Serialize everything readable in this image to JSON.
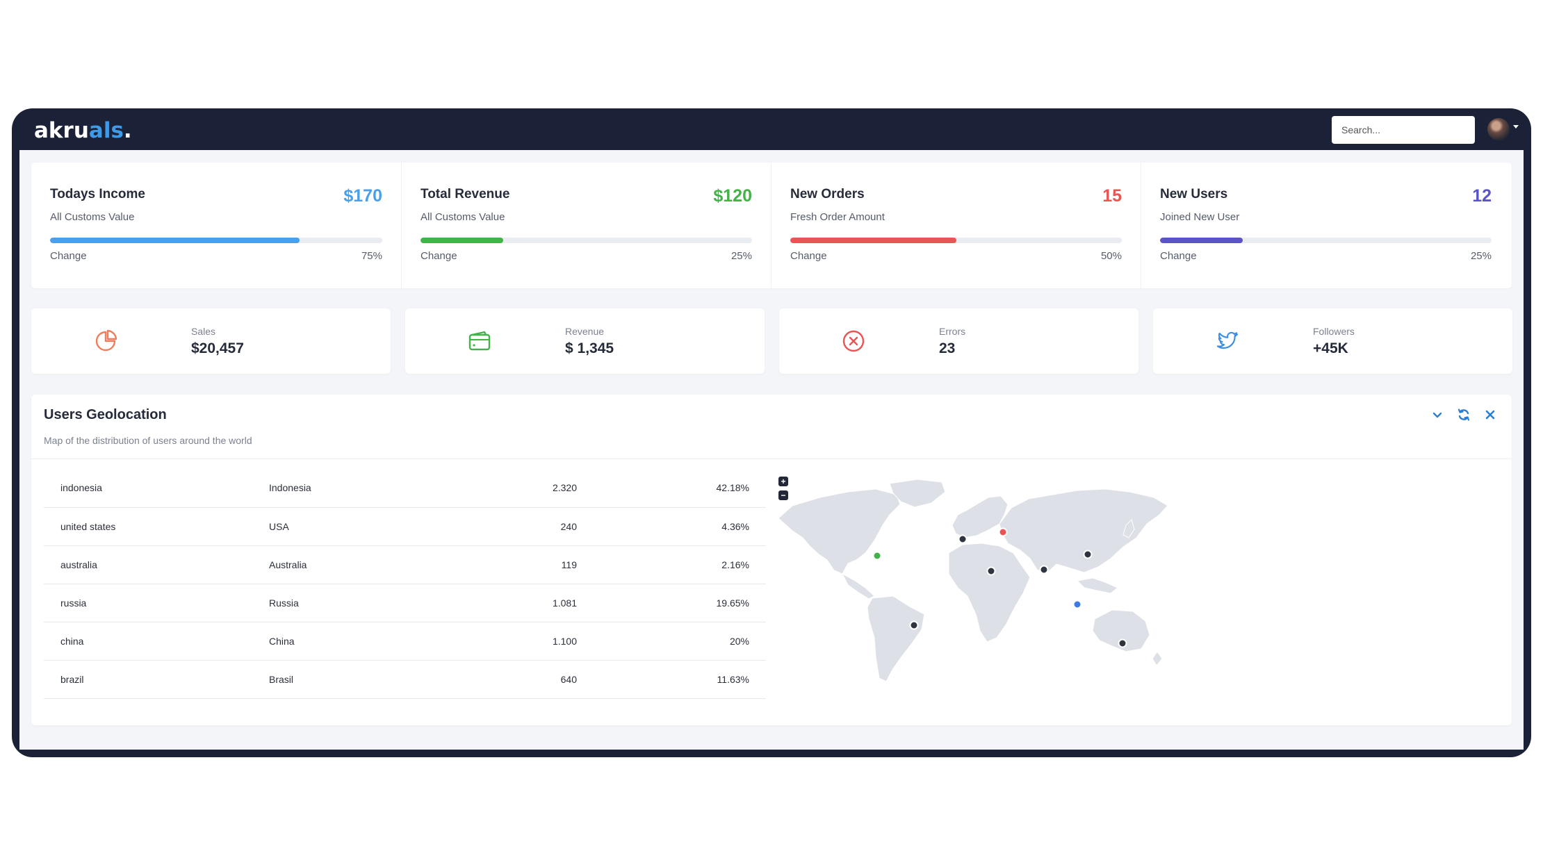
{
  "brand": {
    "logo_main": "akru",
    "logo_accent": "als",
    "logo_end": "."
  },
  "header": {
    "search_placeholder": "Search..."
  },
  "stats": [
    {
      "title": "Todays Income",
      "subtitle": "All Customs Value",
      "value": "$170",
      "change_label": "Change",
      "percent": "75%",
      "progress": 0.75,
      "color": "#4a9fe8"
    },
    {
      "title": "Total Revenue",
      "subtitle": "All Customs Value",
      "value": "$120",
      "change_label": "Change",
      "percent": "25%",
      "progress": 0.25,
      "color": "#43b349"
    },
    {
      "title": "New Orders",
      "subtitle": "Fresh Order Amount",
      "value": "15",
      "change_label": "Change",
      "percent": "50%",
      "progress": 0.5,
      "color": "#e95454"
    },
    {
      "title": "New Users",
      "subtitle": "Joined New User",
      "value": "12",
      "change_label": "Change",
      "percent": "25%",
      "progress": 0.25,
      "color": "#5b54c9"
    }
  ],
  "cards": [
    {
      "label": "Sales",
      "value": "$20,457",
      "icon": "pie-chart-icon",
      "color": "#ef7c5a"
    },
    {
      "label": "Revenue",
      "value": "$ 1,345",
      "icon": "wallet-icon",
      "color": "#43b349"
    },
    {
      "label": "Errors",
      "value": "23",
      "icon": "x-circle-icon",
      "color": "#e95454"
    },
    {
      "label": "Followers",
      "value": "+45K",
      "icon": "twitter-icon",
      "color": "#3d8fe0"
    }
  ],
  "geo": {
    "title": "Users Geolocation",
    "subtitle": "Map of the distribution of users around the world",
    "rows": [
      {
        "code": "indonesia",
        "country": "Indonesia",
        "count": "2.320",
        "percent": "42.18%"
      },
      {
        "code": "united states",
        "country": "USA",
        "count": "240",
        "percent": "4.36%"
      },
      {
        "code": "australia",
        "country": "Australia",
        "count": "119",
        "percent": "2.16%"
      },
      {
        "code": "russia",
        "country": "Russia",
        "count": "1.081",
        "percent": "19.65%"
      },
      {
        "code": "china",
        "country": "China",
        "count": "1.100",
        "percent": "20%"
      },
      {
        "code": "brazil",
        "country": "Brasil",
        "count": "640",
        "percent": "11.63%"
      }
    ],
    "zoom_in": "+",
    "zoom_out": "−"
  },
  "colors": {
    "frame": "#1b2136",
    "accent": "#3d9be9",
    "marker_dark": "#2f3440",
    "marker_green": "#43b349",
    "marker_red": "#e95454",
    "marker_blue": "#3d7be0"
  }
}
